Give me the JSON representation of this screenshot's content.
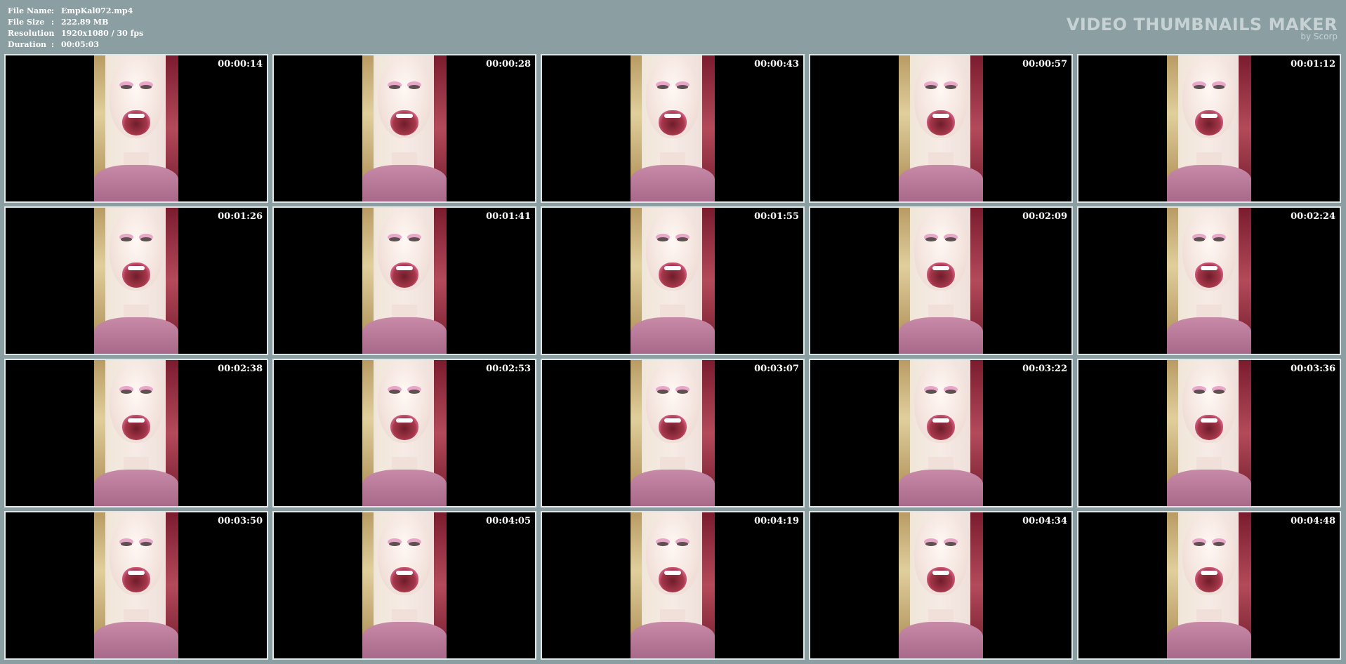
{
  "meta": {
    "rows": [
      {
        "label": "File Name",
        "sep": ":",
        "value": "EmpKal072.mp4"
      },
      {
        "label": "File Size",
        "sep": ":",
        "value": "222.89 MB"
      },
      {
        "label": "Resolution",
        "sep": ":",
        "value": "1920x1080 / 30 fps"
      },
      {
        "label": "Duration",
        "sep": ":",
        "value": "00:05:03"
      }
    ]
  },
  "brand": {
    "title": "VIDEO THUMBNAILS MAKER",
    "subtitle": "by Scorp"
  },
  "thumbnails": [
    {
      "time": "00:00:14"
    },
    {
      "time": "00:00:28"
    },
    {
      "time": "00:00:43"
    },
    {
      "time": "00:00:57"
    },
    {
      "time": "00:01:12"
    },
    {
      "time": "00:01:26"
    },
    {
      "time": "00:01:41"
    },
    {
      "time": "00:01:55"
    },
    {
      "time": "00:02:09"
    },
    {
      "time": "00:02:24"
    },
    {
      "time": "00:02:38"
    },
    {
      "time": "00:02:53"
    },
    {
      "time": "00:03:07"
    },
    {
      "time": "00:03:22"
    },
    {
      "time": "00:03:36"
    },
    {
      "time": "00:03:50"
    },
    {
      "time": "00:04:05"
    },
    {
      "time": "00:04:19"
    },
    {
      "time": "00:04:34"
    },
    {
      "time": "00:04:48"
    }
  ],
  "colors": {
    "background": "#8b9ea2",
    "thumbnail_border": "#dfe6e7",
    "brand_text": "#c7d2d4"
  }
}
